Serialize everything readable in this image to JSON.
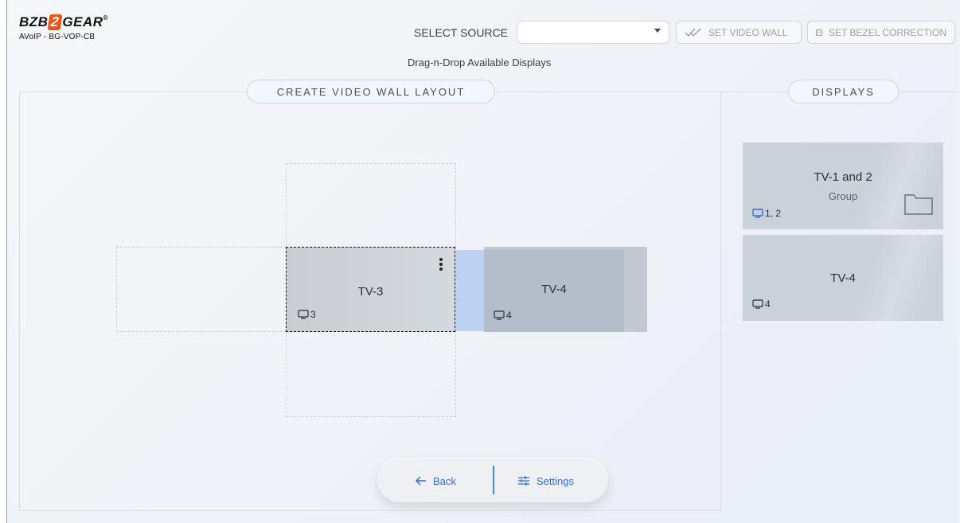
{
  "brand": {
    "logo_prefix": "BZB",
    "logo_mid": "2",
    "logo_suffix": "GEAR",
    "logo_reg": "®",
    "model": "AVoIP - BG-VOP-CB"
  },
  "toolbar": {
    "select_label": "SELECT SOURCE",
    "select_value": "",
    "set_video_wall_label": "SET VIDEO WALL",
    "set_bezel_label": "SET BEZEL CORRECTION"
  },
  "hint": "Drag-n-Drop Available Displays",
  "layout_panel": {
    "title": "CREATE VIDEO WALL LAYOUT",
    "tiles": [
      {
        "label": "TV-3",
        "num": "3"
      },
      {
        "label": "TV-4",
        "num": "4"
      }
    ]
  },
  "displays_panel": {
    "title": "DISPLAYS",
    "cards": [
      {
        "label": "TV-1 and 2",
        "sub": "Group",
        "num": "1, 2"
      },
      {
        "label": "TV-4",
        "num": "4"
      }
    ]
  },
  "footer": {
    "back_label": "Back",
    "settings_label": "Settings"
  },
  "colors": {
    "accent": "#2f6fd6",
    "brand_orange": "#e8541a",
    "drop_gap": "#bdd2f2"
  }
}
